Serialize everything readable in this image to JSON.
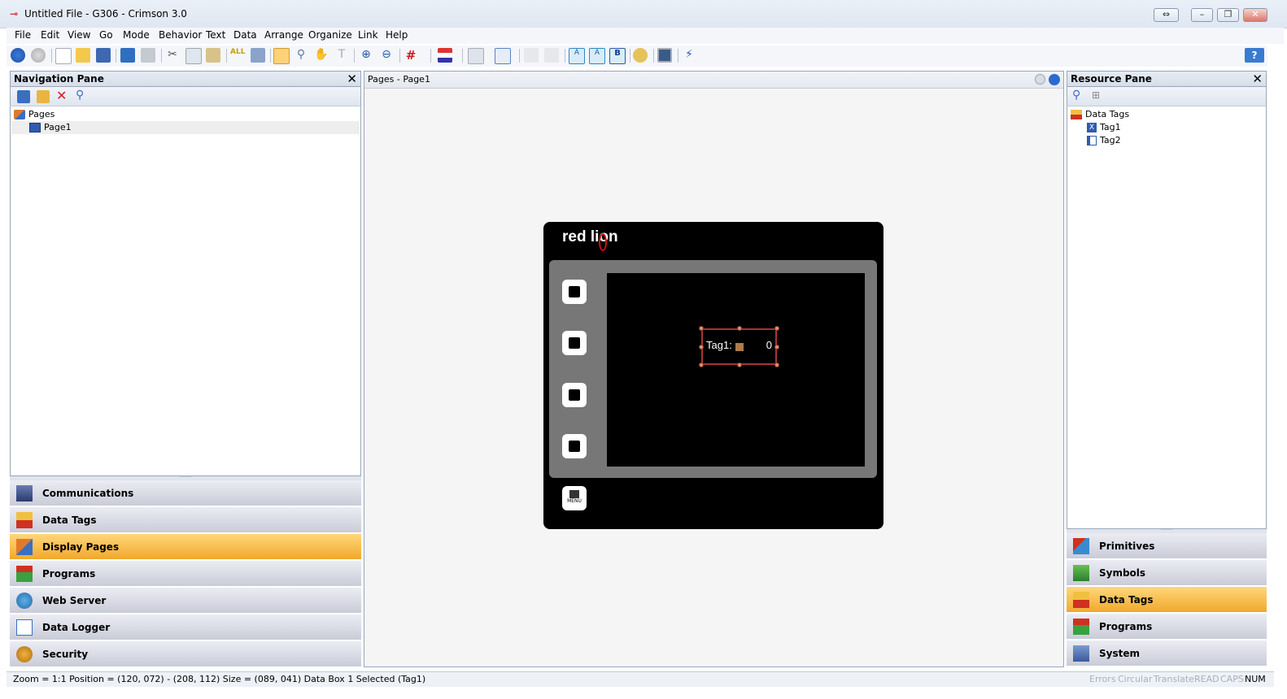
{
  "window": {
    "title": "Untitled File - G306 - Crimson 3.0",
    "controls": [
      "⇔",
      "–",
      "❐",
      "✕"
    ]
  },
  "menu": [
    "File",
    "Edit",
    "View",
    "Go",
    "Mode",
    "Behavior",
    "Text",
    "Data",
    "Arrange",
    "Organize",
    "Link",
    "Help"
  ],
  "navigation_pane": {
    "title": "Navigation Pane",
    "tree": [
      {
        "label": "Pages",
        "level": 0
      },
      {
        "label": "Page1",
        "level": 1,
        "selected": true
      }
    ],
    "categories": [
      {
        "label": "Communications",
        "icon": "communications-icon",
        "active": false
      },
      {
        "label": "Data Tags",
        "icon": "data-tags-icon",
        "active": false
      },
      {
        "label": "Display Pages",
        "icon": "display-pages-icon",
        "active": true
      },
      {
        "label": "Programs",
        "icon": "programs-icon",
        "active": false
      },
      {
        "label": "Web Server",
        "icon": "web-server-icon",
        "active": false
      },
      {
        "label": "Data Logger",
        "icon": "data-logger-icon",
        "active": false
      },
      {
        "label": "Security",
        "icon": "security-icon",
        "active": false
      }
    ]
  },
  "editor": {
    "title": "Pages - Page1",
    "device": {
      "logo_text": "red lion",
      "databox_label": "Tag1:",
      "databox_value": "0",
      "menu_key_label": "MENU"
    }
  },
  "resource_pane": {
    "title": "Resource Pane",
    "tree": [
      {
        "label": "Data Tags",
        "level": 0
      },
      {
        "label": "Tag1",
        "level": 1
      },
      {
        "label": "Tag2",
        "level": 1
      }
    ],
    "categories": [
      {
        "label": "Primitives",
        "icon": "primitives-icon",
        "active": false
      },
      {
        "label": "Symbols",
        "icon": "symbols-icon",
        "active": false
      },
      {
        "label": "Data Tags",
        "icon": "data-tags-icon",
        "active": true
      },
      {
        "label": "Programs",
        "icon": "programs-icon",
        "active": false
      },
      {
        "label": "System",
        "icon": "system-icon",
        "active": false
      }
    ]
  },
  "status": {
    "text": "Zoom = 1:1  Position = (120, 072) - (208, 112)  Size = (089, 041)  Data Box 1 Selected  (Tag1)",
    "indicators": [
      {
        "label": "Errors",
        "on": false
      },
      {
        "label": "Circular",
        "on": false
      },
      {
        "label": "Translate",
        "on": false
      },
      {
        "label": "READ",
        "on": false
      },
      {
        "label": "CAPS",
        "on": false
      },
      {
        "label": "NUM",
        "on": true
      }
    ]
  },
  "colors": {
    "accent": "#f0a92c",
    "pane_border": "#98a6bb",
    "selection": "#a33333"
  }
}
